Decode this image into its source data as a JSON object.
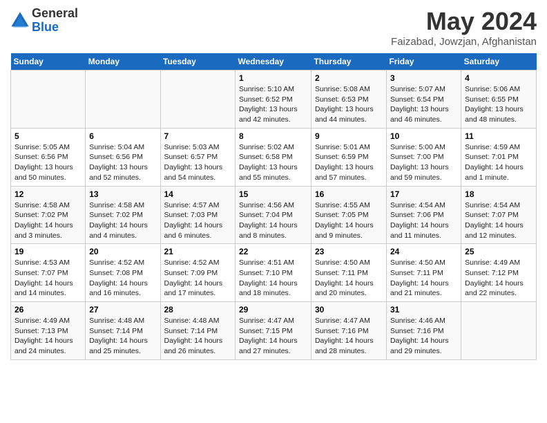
{
  "logo": {
    "general": "General",
    "blue": "Blue"
  },
  "title": "May 2024",
  "location": "Faizabad, Jowzjan, Afghanistan",
  "days_of_week": [
    "Sunday",
    "Monday",
    "Tuesday",
    "Wednesday",
    "Thursday",
    "Friday",
    "Saturday"
  ],
  "weeks": [
    [
      {
        "day": null,
        "content": ""
      },
      {
        "day": null,
        "content": ""
      },
      {
        "day": null,
        "content": ""
      },
      {
        "day": "1",
        "content": "Sunrise: 5:10 AM\nSunset: 6:52 PM\nDaylight: 13 hours\nand 42 minutes."
      },
      {
        "day": "2",
        "content": "Sunrise: 5:08 AM\nSunset: 6:53 PM\nDaylight: 13 hours\nand 44 minutes."
      },
      {
        "day": "3",
        "content": "Sunrise: 5:07 AM\nSunset: 6:54 PM\nDaylight: 13 hours\nand 46 minutes."
      },
      {
        "day": "4",
        "content": "Sunrise: 5:06 AM\nSunset: 6:55 PM\nDaylight: 13 hours\nand 48 minutes."
      }
    ],
    [
      {
        "day": "5",
        "content": "Sunrise: 5:05 AM\nSunset: 6:56 PM\nDaylight: 13 hours\nand 50 minutes."
      },
      {
        "day": "6",
        "content": "Sunrise: 5:04 AM\nSunset: 6:56 PM\nDaylight: 13 hours\nand 52 minutes."
      },
      {
        "day": "7",
        "content": "Sunrise: 5:03 AM\nSunset: 6:57 PM\nDaylight: 13 hours\nand 54 minutes."
      },
      {
        "day": "8",
        "content": "Sunrise: 5:02 AM\nSunset: 6:58 PM\nDaylight: 13 hours\nand 55 minutes."
      },
      {
        "day": "9",
        "content": "Sunrise: 5:01 AM\nSunset: 6:59 PM\nDaylight: 13 hours\nand 57 minutes."
      },
      {
        "day": "10",
        "content": "Sunrise: 5:00 AM\nSunset: 7:00 PM\nDaylight: 13 hours\nand 59 minutes."
      },
      {
        "day": "11",
        "content": "Sunrise: 4:59 AM\nSunset: 7:01 PM\nDaylight: 14 hours\nand 1 minute."
      }
    ],
    [
      {
        "day": "12",
        "content": "Sunrise: 4:58 AM\nSunset: 7:02 PM\nDaylight: 14 hours\nand 3 minutes."
      },
      {
        "day": "13",
        "content": "Sunrise: 4:58 AM\nSunset: 7:02 PM\nDaylight: 14 hours\nand 4 minutes."
      },
      {
        "day": "14",
        "content": "Sunrise: 4:57 AM\nSunset: 7:03 PM\nDaylight: 14 hours\nand 6 minutes."
      },
      {
        "day": "15",
        "content": "Sunrise: 4:56 AM\nSunset: 7:04 PM\nDaylight: 14 hours\nand 8 minutes."
      },
      {
        "day": "16",
        "content": "Sunrise: 4:55 AM\nSunset: 7:05 PM\nDaylight: 14 hours\nand 9 minutes."
      },
      {
        "day": "17",
        "content": "Sunrise: 4:54 AM\nSunset: 7:06 PM\nDaylight: 14 hours\nand 11 minutes."
      },
      {
        "day": "18",
        "content": "Sunrise: 4:54 AM\nSunset: 7:07 PM\nDaylight: 14 hours\nand 12 minutes."
      }
    ],
    [
      {
        "day": "19",
        "content": "Sunrise: 4:53 AM\nSunset: 7:07 PM\nDaylight: 14 hours\nand 14 minutes."
      },
      {
        "day": "20",
        "content": "Sunrise: 4:52 AM\nSunset: 7:08 PM\nDaylight: 14 hours\nand 16 minutes."
      },
      {
        "day": "21",
        "content": "Sunrise: 4:52 AM\nSunset: 7:09 PM\nDaylight: 14 hours\nand 17 minutes."
      },
      {
        "day": "22",
        "content": "Sunrise: 4:51 AM\nSunset: 7:10 PM\nDaylight: 14 hours\nand 18 minutes."
      },
      {
        "day": "23",
        "content": "Sunrise: 4:50 AM\nSunset: 7:11 PM\nDaylight: 14 hours\nand 20 minutes."
      },
      {
        "day": "24",
        "content": "Sunrise: 4:50 AM\nSunset: 7:11 PM\nDaylight: 14 hours\nand 21 minutes."
      },
      {
        "day": "25",
        "content": "Sunrise: 4:49 AM\nSunset: 7:12 PM\nDaylight: 14 hours\nand 22 minutes."
      }
    ],
    [
      {
        "day": "26",
        "content": "Sunrise: 4:49 AM\nSunset: 7:13 PM\nDaylight: 14 hours\nand 24 minutes."
      },
      {
        "day": "27",
        "content": "Sunrise: 4:48 AM\nSunset: 7:14 PM\nDaylight: 14 hours\nand 25 minutes."
      },
      {
        "day": "28",
        "content": "Sunrise: 4:48 AM\nSunset: 7:14 PM\nDaylight: 14 hours\nand 26 minutes."
      },
      {
        "day": "29",
        "content": "Sunrise: 4:47 AM\nSunset: 7:15 PM\nDaylight: 14 hours\nand 27 minutes."
      },
      {
        "day": "30",
        "content": "Sunrise: 4:47 AM\nSunset: 7:16 PM\nDaylight: 14 hours\nand 28 minutes."
      },
      {
        "day": "31",
        "content": "Sunrise: 4:46 AM\nSunset: 7:16 PM\nDaylight: 14 hours\nand 29 minutes."
      },
      {
        "day": null,
        "content": ""
      }
    ]
  ]
}
